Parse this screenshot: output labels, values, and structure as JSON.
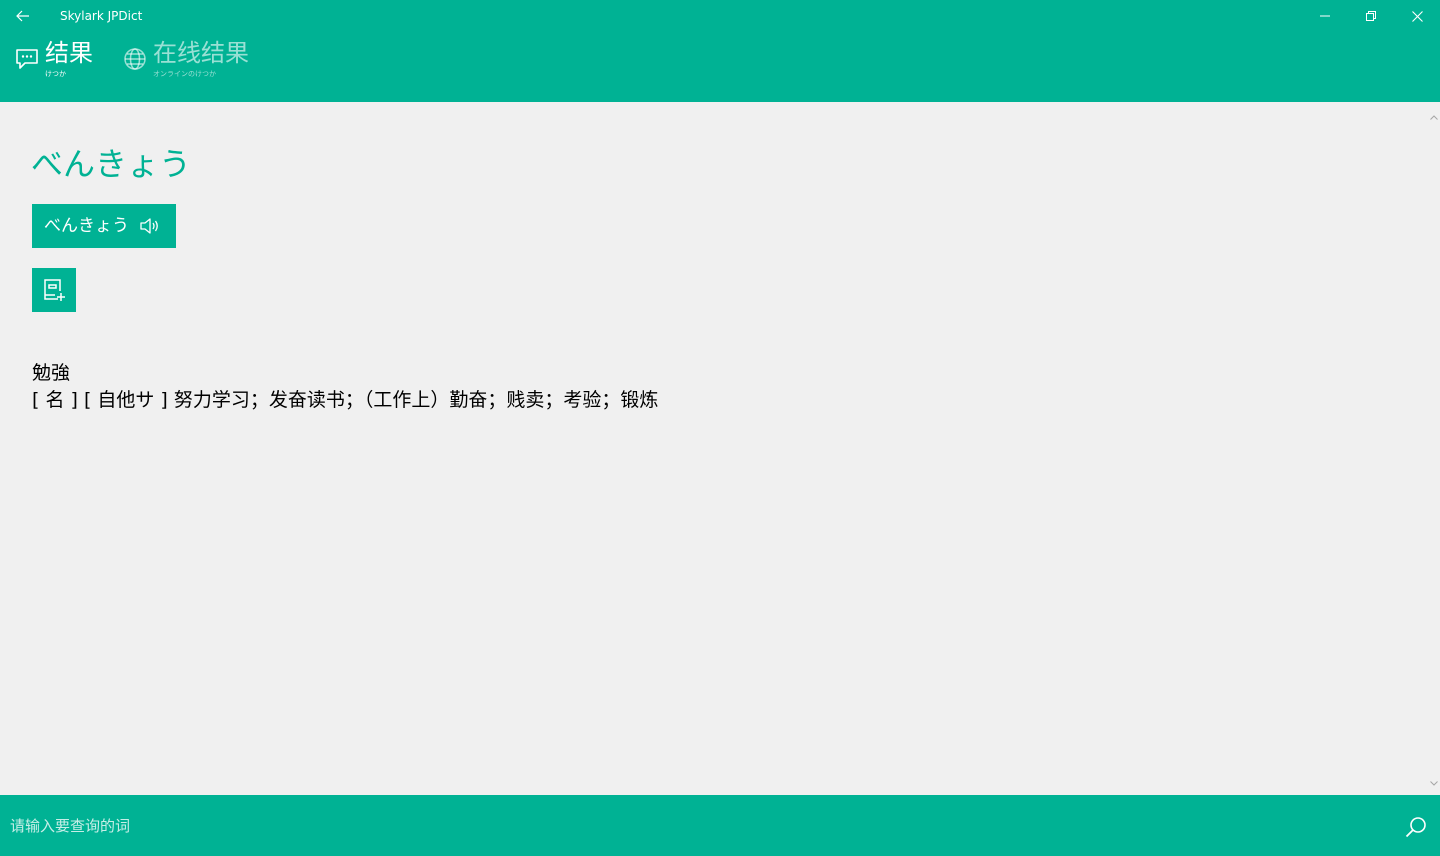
{
  "window": {
    "title": "Skylark JPDict",
    "back_icon": "arrow-left-icon",
    "minimize_icon": "minimize-icon",
    "restore_icon": "restore-icon",
    "close_icon": "close-icon"
  },
  "tabs": [
    {
      "label": "结果",
      "sub": "けつか",
      "icon": "chat-bubble-icon",
      "selected": true
    },
    {
      "label": "在线结果",
      "sub": "オンラインのけつか",
      "icon": "globe-icon",
      "selected": false
    }
  ],
  "entry": {
    "reading": "べんきょう",
    "pronounce_label": "べんきょう",
    "pronounce_icon": "speaker-icon",
    "add_icon": "add-to-notebook-icon",
    "kanji": "勉強",
    "definition": "[ 名 ] [ 自他サ ] 努力学习；发奋读书；（工作上）勤奋；贱卖；考验；锻炼"
  },
  "search": {
    "placeholder": "请输入要查询的词",
    "value": "",
    "icon": "search-icon"
  },
  "colors": {
    "accent": "#00b294",
    "background": "#f0f0f0",
    "text": "#000000"
  }
}
